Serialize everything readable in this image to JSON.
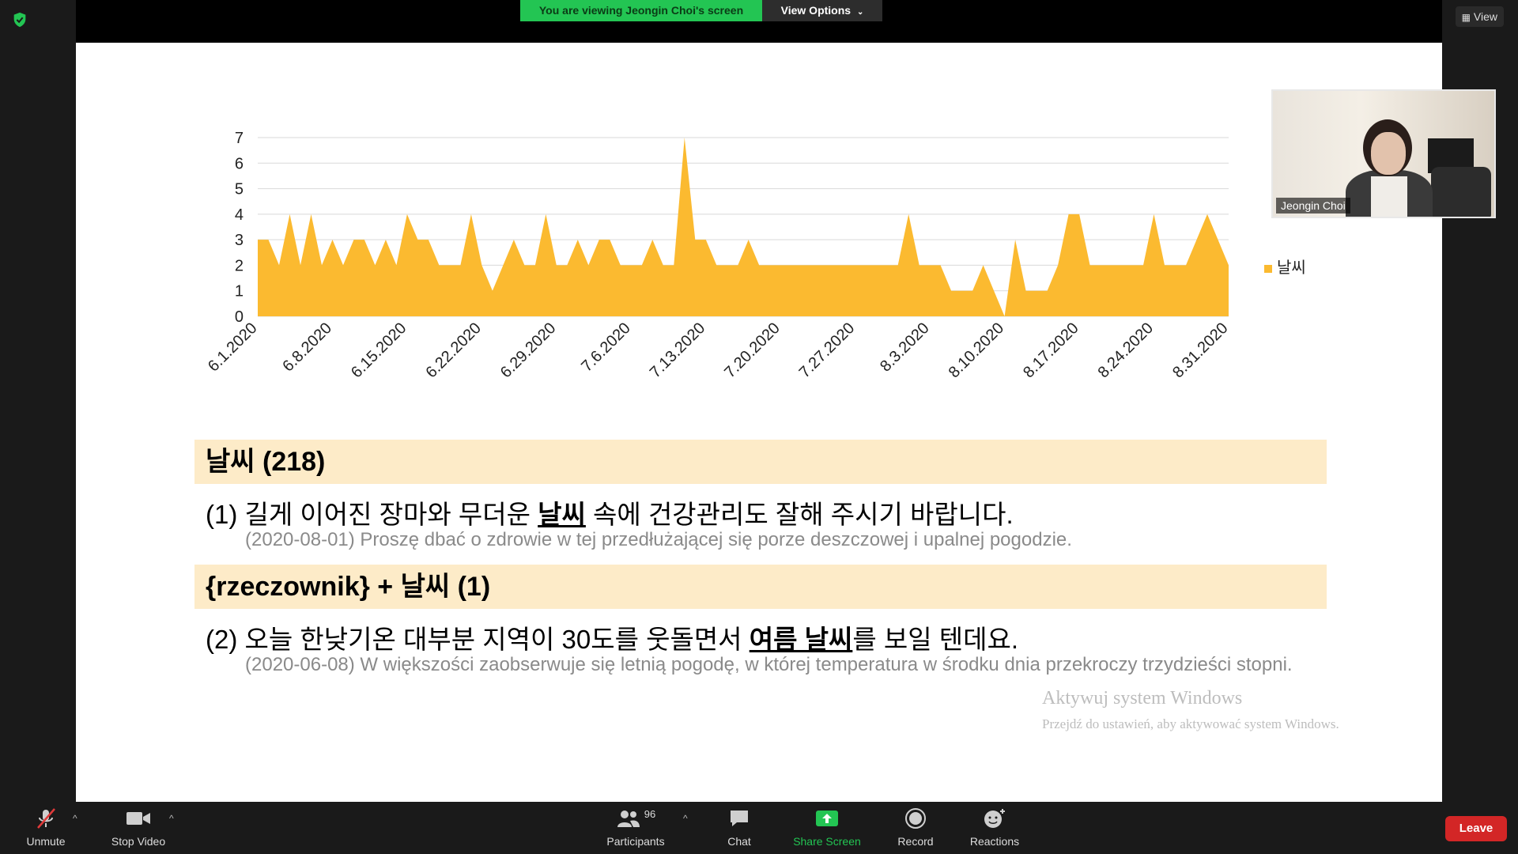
{
  "banner": {
    "viewing_text": "You are viewing Jeongin Choi's screen",
    "view_options_label": "View Options",
    "view_label": "View"
  },
  "chart_data": {
    "type": "area",
    "legend": [
      "날씨"
    ],
    "color": "#FBBA30",
    "ylim": [
      0,
      7
    ],
    "y_ticks": [
      "0",
      "1",
      "2",
      "3",
      "4",
      "5",
      "6",
      "7"
    ],
    "x_tick_labels": [
      "6.1.2020",
      "6.8.2020",
      "6.15.2020",
      "6.22.2020",
      "6.29.2020",
      "7.6.2020",
      "7.13.2020",
      "7.20.2020",
      "7.27.2020",
      "8.3.2020",
      "8.10.2020",
      "8.17.2020",
      "8.24.2020",
      "8.31.2020"
    ],
    "x_start": "6.1.2020",
    "x_end": "8.31.2020",
    "series": [
      {
        "name": "날씨",
        "values": [
          3,
          3,
          2,
          4,
          2,
          4,
          2,
          3,
          2,
          3,
          3,
          2,
          3,
          2,
          4,
          3,
          3,
          2,
          2,
          2,
          4,
          2,
          1,
          2,
          3,
          2,
          2,
          4,
          2,
          2,
          3,
          2,
          3,
          3,
          2,
          2,
          2,
          3,
          2,
          2,
          7,
          3,
          3,
          2,
          2,
          2,
          3,
          2,
          2,
          2,
          2,
          2,
          2,
          2,
          2,
          2,
          2,
          2,
          2,
          2,
          2,
          4,
          2,
          2,
          2,
          1,
          1,
          1,
          2,
          1,
          0,
          3,
          1,
          1,
          1,
          2,
          4,
          4,
          2,
          2,
          2,
          2,
          2,
          2,
          4,
          2,
          2,
          2,
          3,
          4,
          3,
          2
        ]
      }
    ]
  },
  "sections": [
    {
      "header": "날씨 (218)",
      "example": {
        "num": "(1)",
        "before": "길게 이어진 장마와 무더운 ",
        "highlight": "날씨",
        "after": " 속에 건강관리도 잘해 주시기 바랍니다."
      },
      "translation": "(2020-08-01) Proszę dbać o zdrowie w tej przedłużającej się porze deszczowej i upalnej pogodzie."
    },
    {
      "header": "{rzeczownik} + 날씨 (1)",
      "example": {
        "num": "(2)",
        "before": "오늘 한낮기온 대부분 지역이 30도를 웃돌면서 ",
        "highlight": "여름 날씨",
        "after": "를 보일 텐데요."
      },
      "translation": "(2020-06-08) W większości zaobserwuje się letnią pogodę, w której temperatura w środku dnia przekroczy trzydzieści stopni."
    }
  ],
  "watermark": {
    "line1": "Aktywuj system Windows",
    "line2": "Przejdź do ustawień, aby aktywować system Windows."
  },
  "speaker": {
    "name": "Jeongin Choi"
  },
  "toolbar": {
    "unmute": "Unmute",
    "stop_video": "Stop Video",
    "participants": "Participants",
    "participants_count": "96",
    "chat": "Chat",
    "share_screen": "Share Screen",
    "record": "Record",
    "reactions": "Reactions",
    "leave": "Leave"
  },
  "colors": {
    "banner_green": "#23c553",
    "share_green": "#23c553",
    "leave_red": "#d32626",
    "chart_fill": "#FBBA30",
    "section_bg": "#fdebc8"
  }
}
